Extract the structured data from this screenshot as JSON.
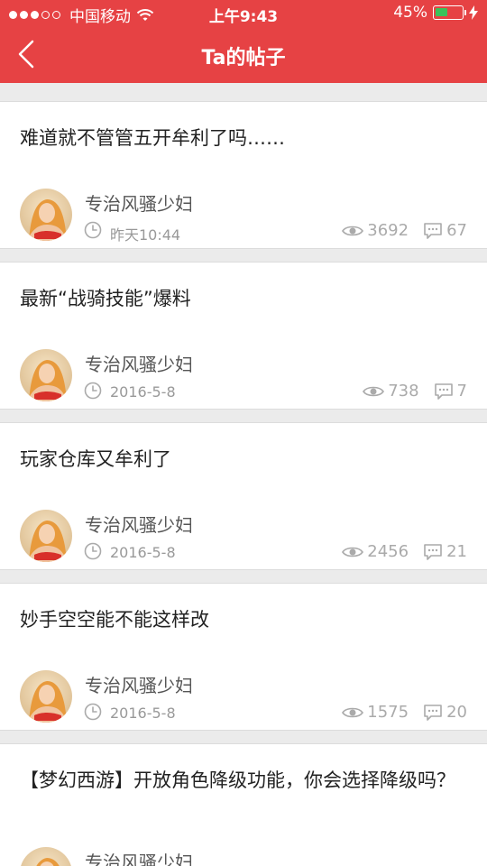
{
  "status_bar": {
    "carrier": "中国移动",
    "time": "上午9:43",
    "battery": "45%",
    "battery_level": 0.45
  },
  "header": {
    "title": "Ta的帖子"
  },
  "colors": {
    "header_bg": "#e64244",
    "battery_fill": "#3ac25a",
    "meta_gray": "#999999"
  },
  "posts": [
    {
      "title": "难道就不管管五开牟利了吗……",
      "author": "专治风骚少妇",
      "time": "昨天10:44",
      "views": "3692",
      "comments": "67"
    },
    {
      "title": "最新“战骑技能”爆料",
      "author": "专治风骚少妇",
      "time": "2016-5-8",
      "views": "738",
      "comments": "7"
    },
    {
      "title": "玩家仓库又牟利了",
      "author": "专治风骚少妇",
      "time": "2016-5-8",
      "views": "2456",
      "comments": "21"
    },
    {
      "title": "妙手空空能不能这样改",
      "author": "专治风骚少妇",
      "time": "2016-5-8",
      "views": "1575",
      "comments": "20"
    },
    {
      "title": "【梦幻西游】开放角色降级功能，你会选择降级吗？",
      "author": "专治风骚少妇"
    }
  ]
}
